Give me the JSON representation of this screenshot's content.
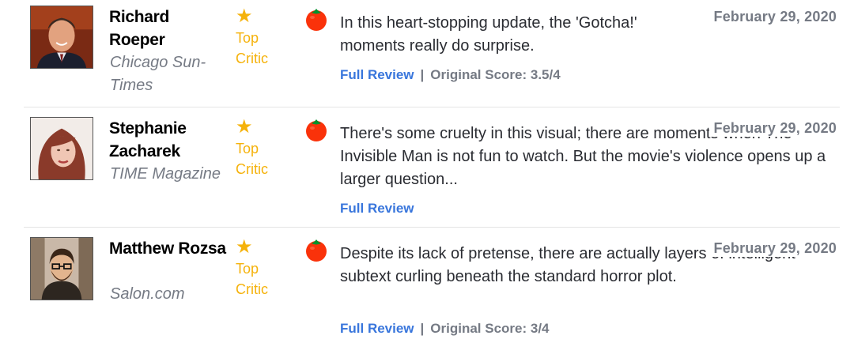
{
  "reviews": [
    {
      "critic": "Richard Roeper",
      "publication": "Chicago Sun-Times",
      "top_critic_label": "Top Critic",
      "quote": "In this heart-stopping update, the 'Gotcha!' moments really do surprise.",
      "date": "February 29, 2020",
      "full_review_label": "Full Review",
      "separator": "|",
      "original_score": "Original Score: 3.5/4",
      "freshness": "fresh-tomato-icon"
    },
    {
      "critic": "Stephanie Zacharek",
      "publication": "TIME Magazine",
      "top_critic_label": "Top Critic",
      "quote": "There's some cruelty in this visual; there are moments when The Invisible Man is not fun to watch. But the movie's violence opens up a larger question...",
      "date": "February 29, 2020",
      "full_review_label": "Full Review",
      "freshness": "fresh-tomato-icon"
    },
    {
      "critic": "Matthew Rozsa",
      "publication": "Salon.com",
      "top_critic_label": "Top Critic",
      "quote": "Despite its lack of pretense, there are actually layers of intelligent subtext curling beneath the standard horror plot.",
      "date": "February 29, 2020",
      "full_review_label": "Full Review",
      "separator": "|",
      "original_score": "Original Score: 3/4",
      "freshness": "fresh-tomato-icon"
    }
  ],
  "colors": {
    "top_critic": "#f5b20b",
    "link": "#3976dc",
    "muted": "#757a84",
    "tomato": "#fa320a"
  }
}
